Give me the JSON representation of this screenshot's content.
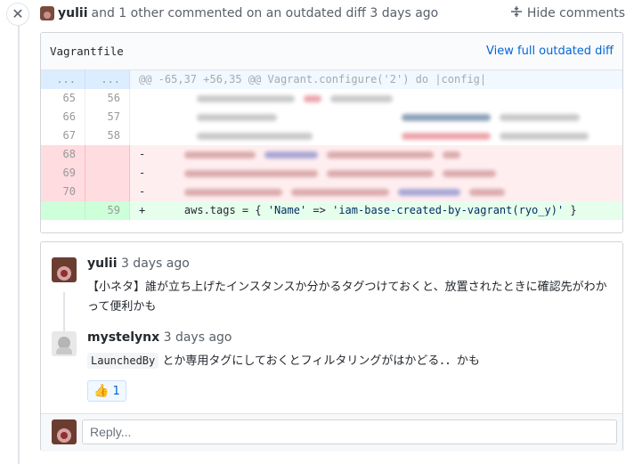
{
  "header": {
    "author": "yulii",
    "summary": "and 1 other commented on an outdated diff 3 days ago",
    "hide_label": "Hide comments",
    "close_glyph": "✕"
  },
  "file": {
    "name": "Vagrantfile",
    "view_link": "View full outdated diff"
  },
  "diff": {
    "hunk": {
      "old": "...",
      "new": "...",
      "text": "@@ -65,37 +56,35 @@ Vagrant.configure('2') do |config|"
    },
    "context": [
      {
        "old": "65",
        "new": "56"
      },
      {
        "old": "66",
        "new": "57"
      },
      {
        "old": "67",
        "new": "58"
      }
    ],
    "deleted": [
      {
        "old": "68",
        "sign": "-"
      },
      {
        "old": "69",
        "sign": "-"
      },
      {
        "old": "70",
        "sign": "-"
      }
    ],
    "added": {
      "new": "59",
      "sign": "+",
      "prefix": "aws.tags = { ",
      "key": "'Name'",
      "arrow": " => ",
      "value": "'iam-base-created-by-vagrant(ryo_y)'",
      "suffix": " }"
    }
  },
  "comments": [
    {
      "author": "yulii",
      "time": "3 days ago",
      "body": "【小ネタ】誰が立ち上げたインスタンスか分かるタグつけておくと、放置されたときに確認先がわかって便利かも"
    },
    {
      "author": "mystelynx",
      "time": "3 days ago",
      "code": "LaunchedBy",
      "body": " とか専用タグにしておくとフィルタリングがはかどる．．かも",
      "reaction_icon": "👍",
      "reaction_count": "1"
    }
  ],
  "reply": {
    "placeholder": "Reply..."
  }
}
